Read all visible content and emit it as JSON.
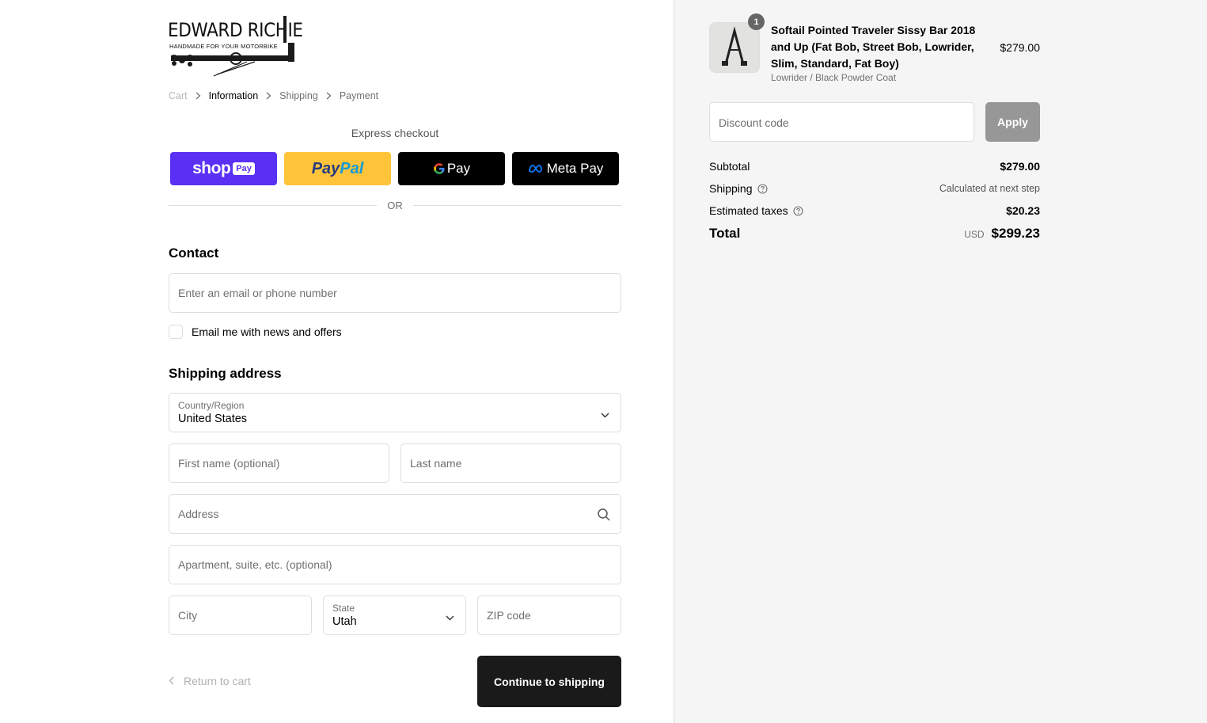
{
  "brand": {
    "name": "EDWARD RICHIE",
    "tagline": "HANDMADE FOR YOUR MOTORBIKE"
  },
  "breadcrumb": [
    "Cart",
    "Information",
    "Shipping",
    "Payment"
  ],
  "express": {
    "label": "Express checkout",
    "shop_pay": {
      "word": "shop",
      "pill": "Pay"
    },
    "paypal": {
      "a": "Pay",
      "b": "Pal"
    },
    "gpay": "Pay",
    "meta_pay": "Meta Pay",
    "or": "OR"
  },
  "contact": {
    "title": "Contact",
    "email_placeholder": "Enter an email or phone number",
    "newsletter_label": "Email me with news and offers",
    "newsletter_checked": false
  },
  "shipping": {
    "title": "Shipping address",
    "country_label": "Country/Region",
    "country_value": "United States",
    "first_name_placeholder": "First name (optional)",
    "last_name_placeholder": "Last name",
    "address_placeholder": "Address",
    "apartment_placeholder": "Apartment, suite, etc. (optional)",
    "city_placeholder": "City",
    "state_label": "State",
    "state_value": "Utah",
    "zip_placeholder": "ZIP code"
  },
  "footer": {
    "return_label": "Return to cart",
    "continue_label": "Continue to shipping"
  },
  "order": {
    "quantity": "1",
    "product_name": "Softail Pointed Traveler Sissy Bar 2018 and Up (Fat Bob, Street Bob, Lowrider, Slim, Standard, Fat Boy)",
    "variant": "Lowrider / Black Powder Coat",
    "price": "$279.00",
    "discount_placeholder": "Discount code",
    "apply_label": "Apply",
    "subtotal_label": "Subtotal",
    "subtotal_value": "$279.00",
    "shipping_label": "Shipping",
    "shipping_value": "Calculated at next step",
    "taxes_label": "Estimated taxes",
    "taxes_value": "$20.23",
    "total_label": "Total",
    "currency": "USD",
    "total_value": "$299.23"
  },
  "colors": {
    "shop_pay": "#5a31f4",
    "paypal": "#ffc439",
    "continue_button": "#1a1a1a",
    "apply_button": "#979797",
    "sidebar_bg": "#f5f5f5"
  }
}
